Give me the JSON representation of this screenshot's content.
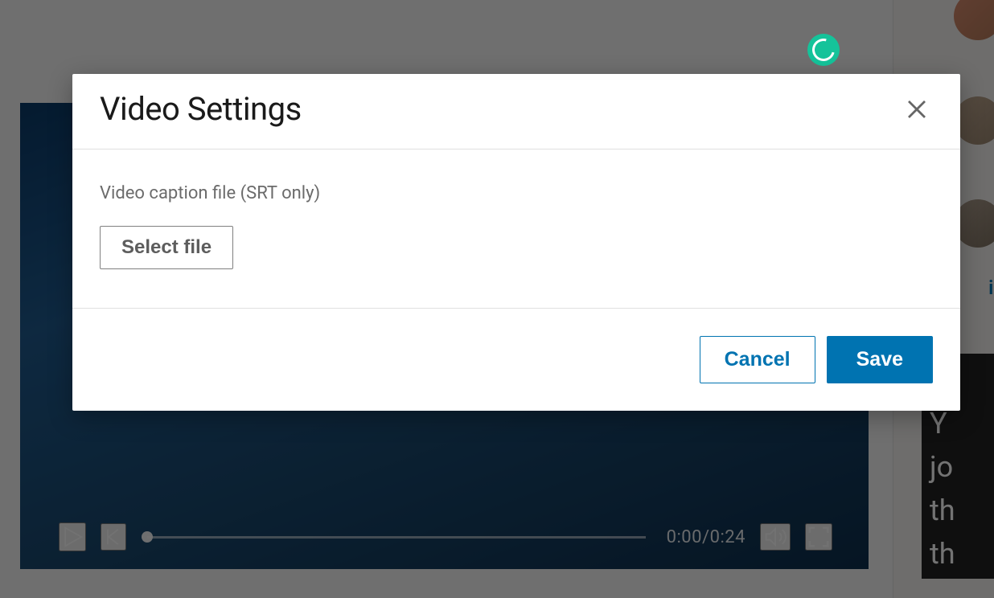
{
  "modal": {
    "title": "Video Settings",
    "caption_label": "Video caption file (SRT only)",
    "select_file_label": "Select file",
    "cancel_label": "Cancel",
    "save_label": "Save"
  },
  "video": {
    "time_display": "0:00/0:24"
  },
  "sidebar": {
    "view_link": "iew",
    "card_text": "Y\njo\nth\nth"
  },
  "icons": {
    "close": "close-icon",
    "play": "play-icon",
    "prev": "prev-track-icon",
    "volume": "volume-icon",
    "fullscreen": "fullscreen-icon",
    "grammarly": "grammarly-icon"
  }
}
